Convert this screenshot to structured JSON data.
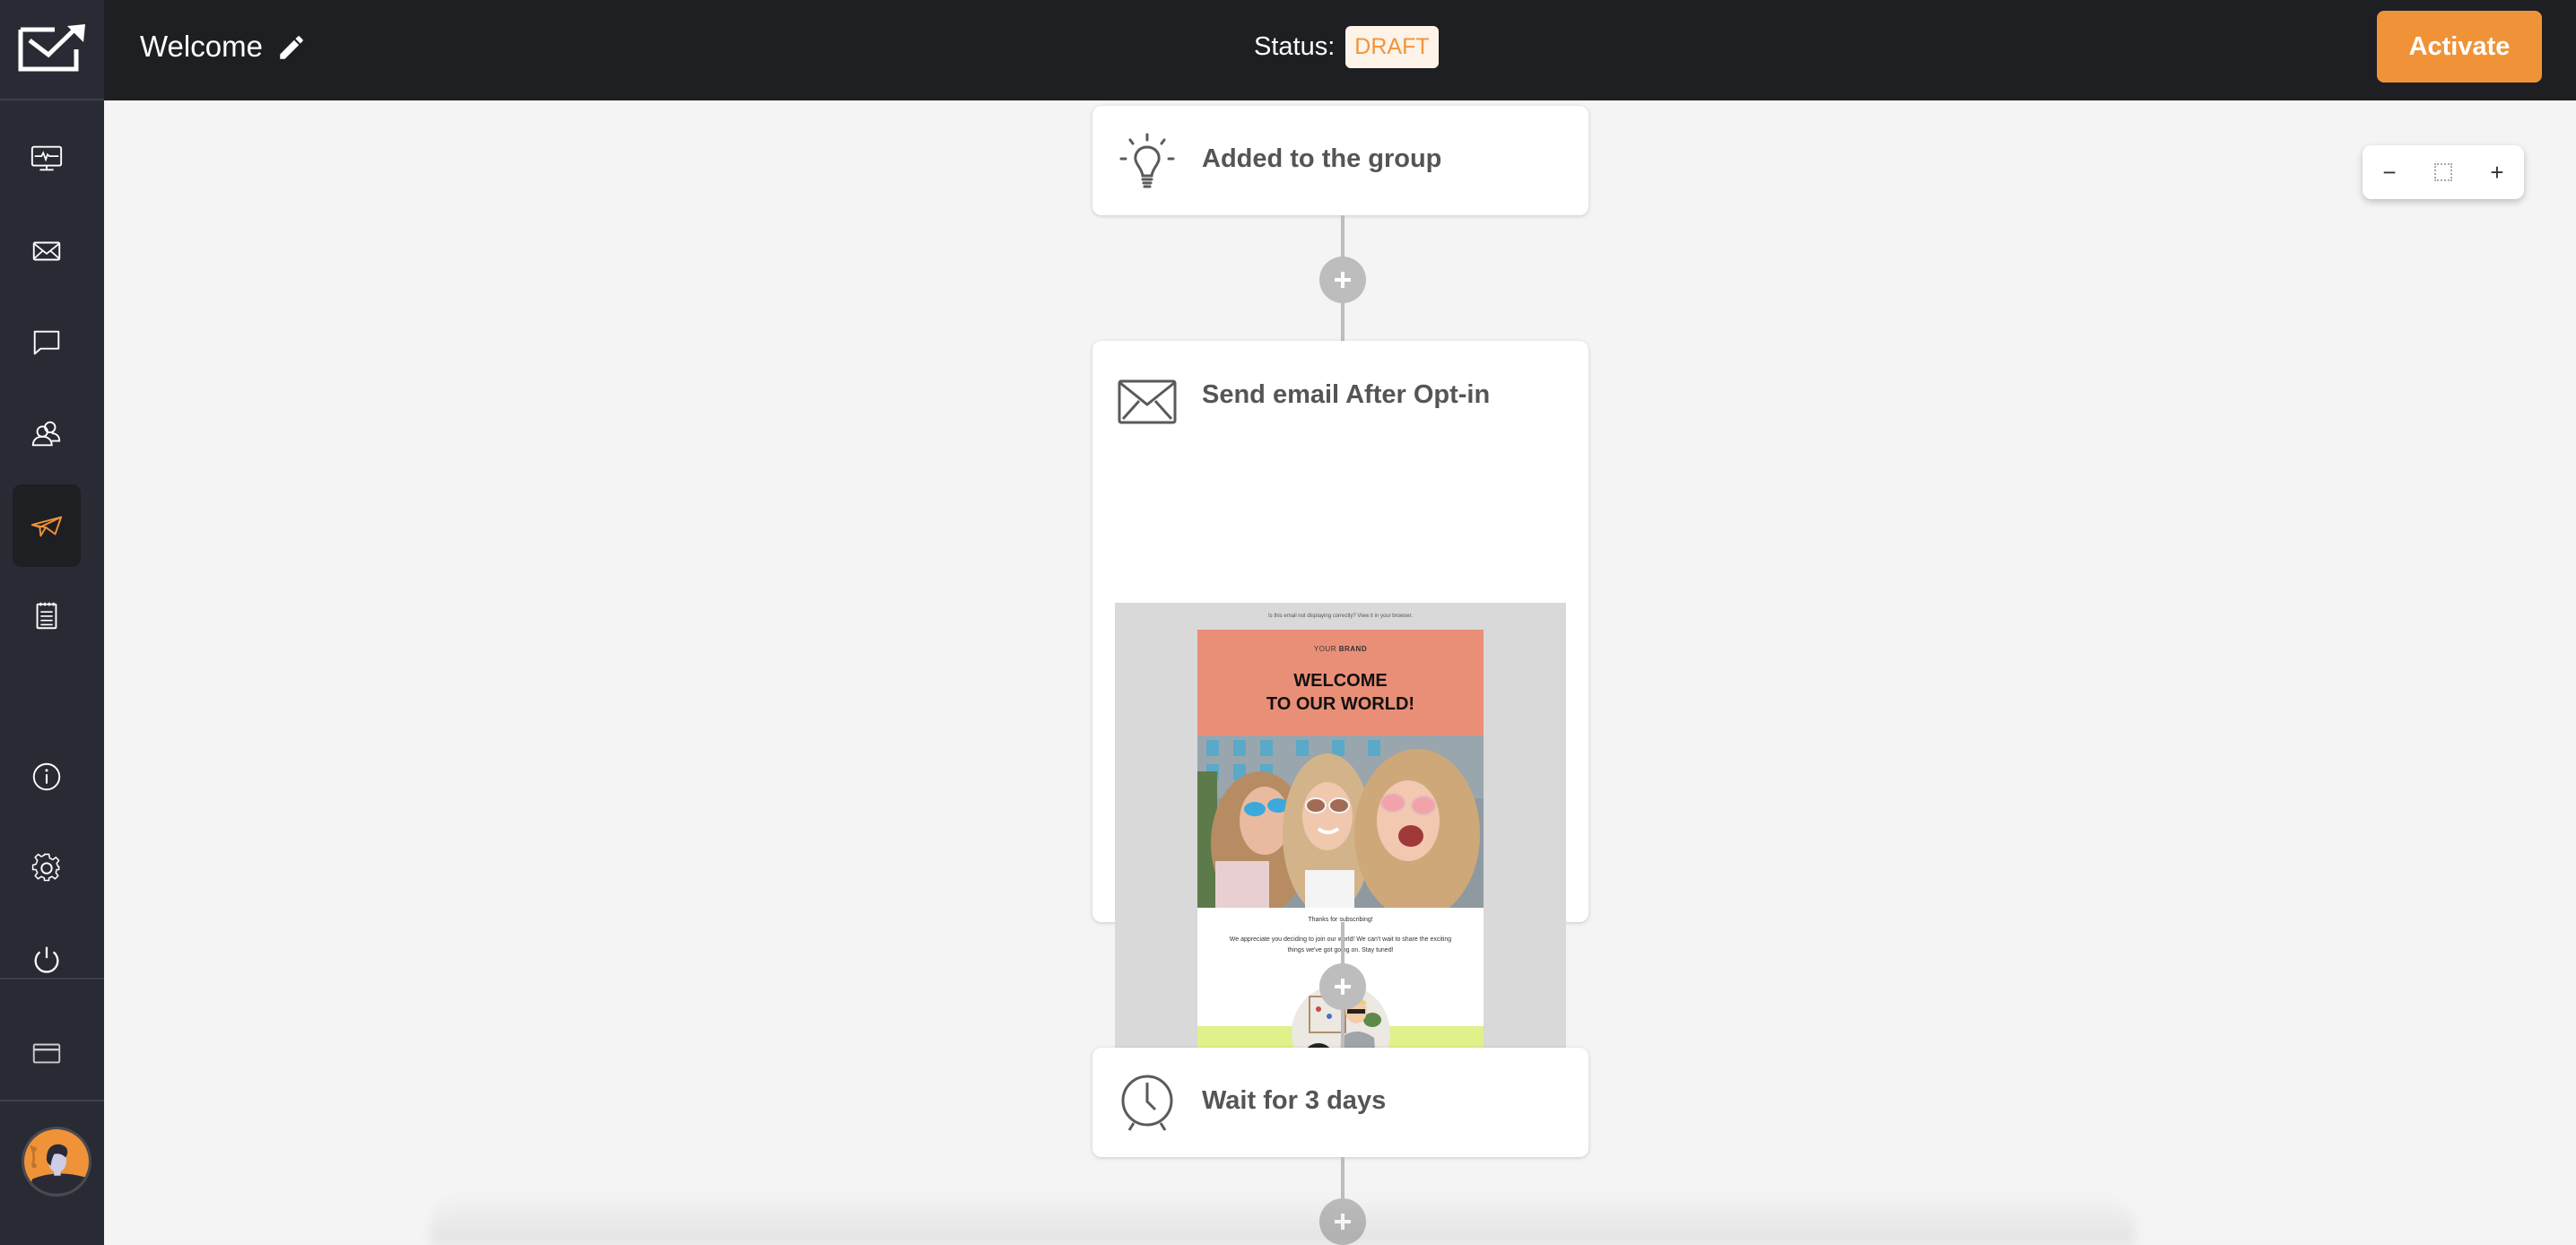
{
  "header": {
    "title": "Welcome",
    "status_label": "Status:",
    "status_value": "DRAFT",
    "activate_label": "Activate"
  },
  "colors": {
    "accent": "#f09338",
    "header_bg": "#1e1f23",
    "sidebar_bg": "#282b34",
    "canvas_bg": "#f4f4f4",
    "draft_badge_bg": "#fdf3e8",
    "draft_badge_text": "#f0943a",
    "connector": "#bdbdbd"
  },
  "sidebar": {
    "items": [
      {
        "name": "dashboard",
        "icon": "monitor-pulse-icon",
        "active": false
      },
      {
        "name": "campaigns",
        "icon": "envelope-icon",
        "active": false
      },
      {
        "name": "forms",
        "icon": "chat-bubble-icon",
        "active": false
      },
      {
        "name": "subscribers",
        "icon": "users-icon",
        "active": false
      },
      {
        "name": "automations",
        "icon": "paper-plane-icon",
        "active": true
      },
      {
        "name": "sites",
        "icon": "notepad-icon",
        "active": false
      },
      {
        "name": "help",
        "icon": "info-icon",
        "active": false
      },
      {
        "name": "settings",
        "icon": "gear-icon",
        "active": false
      },
      {
        "name": "logout",
        "icon": "power-icon",
        "active": false
      },
      {
        "name": "billing",
        "icon": "credit-card-icon",
        "active": false
      }
    ]
  },
  "workflow": {
    "steps": [
      {
        "type": "trigger",
        "icon": "lightbulb-icon",
        "title": "Added to the group"
      },
      {
        "type": "email",
        "icon": "envelope-icon",
        "title": "Send email After Opt-in",
        "preview": {
          "top_note": "Is this email not displaying correctly? View it in your browser.",
          "brand_prefix": "YOUR ",
          "brand_bold": "BRAND",
          "headline_line1": "WELCOME",
          "headline_line2": "TO OUR WORLD!",
          "thanks": "Thanks for subscribing!",
          "body": "We appreciate you deciding to join our world! We can't wait to share the exciting things we've got going on. Stay tuned!"
        }
      },
      {
        "type": "delay",
        "icon": "clock-icon",
        "title": "Wait for 3 days"
      }
    ]
  },
  "zoom_controls": {
    "zoom_out": "−",
    "zoom_in": "+"
  }
}
